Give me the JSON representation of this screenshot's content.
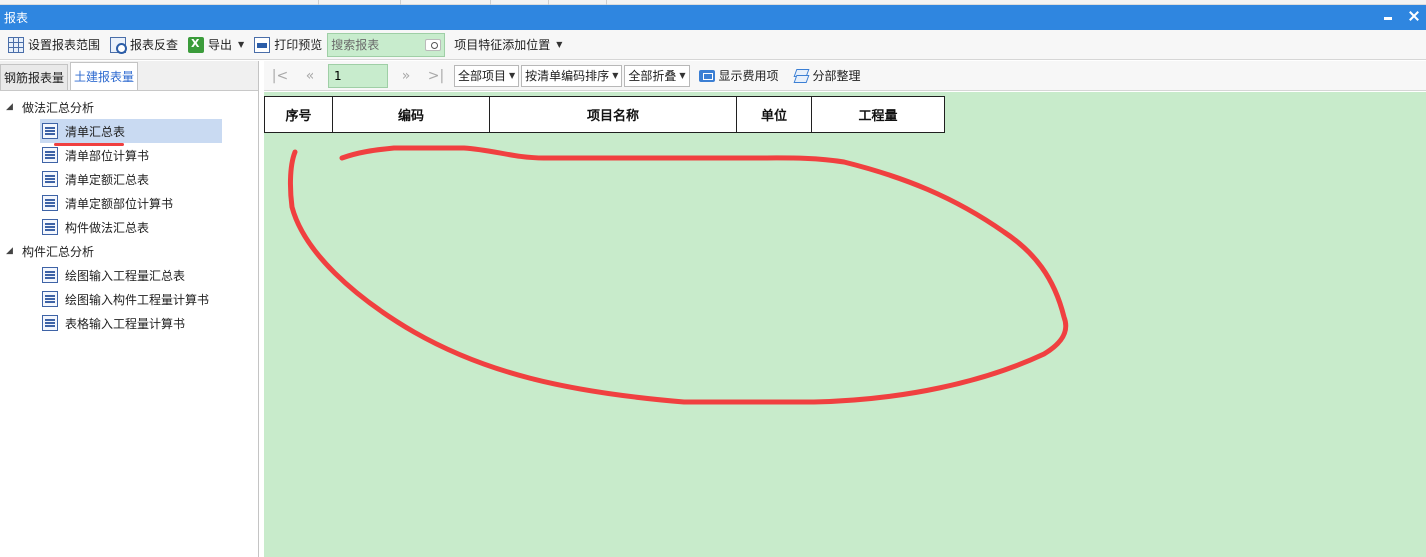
{
  "window": {
    "title": "报表"
  },
  "toolbar": {
    "set_range": "设置报表范围",
    "reverse_check": "报表反查",
    "export": "导出",
    "print_preview": "打印预览",
    "search_placeholder": "搜索报表",
    "feature_position": "项目特征添加位置"
  },
  "left_tabs": [
    "钢筋报表量",
    "土建报表量"
  ],
  "active_left_tab": "土建报表量",
  "tree": [
    {
      "label": "做法汇总分析",
      "items": [
        "清单汇总表",
        "清单部位计算书",
        "清单定额汇总表",
        "清单定额部位计算书",
        "构件做法汇总表"
      ]
    },
    {
      "label": "构件汇总分析",
      "items": [
        "绘图输入工程量汇总表",
        "绘图输入构件工程量计算书",
        "表格输入工程量计算书"
      ]
    }
  ],
  "selected_item": "清单汇总表",
  "nav": {
    "page": "1",
    "filter_items": "全部项目",
    "sort_order": "按清单编码排序",
    "fold": "全部折叠",
    "show_fee": "显示费用项",
    "section_sort": "分部整理"
  },
  "report": {
    "columns": [
      "序号",
      "编码",
      "项目名称",
      "单位",
      "工程量"
    ]
  },
  "colors": {
    "title_bar": "#2f86e0",
    "report_background": "#c8ebcb",
    "annotation": "#f04040",
    "selected_row": "#c9daf2"
  }
}
